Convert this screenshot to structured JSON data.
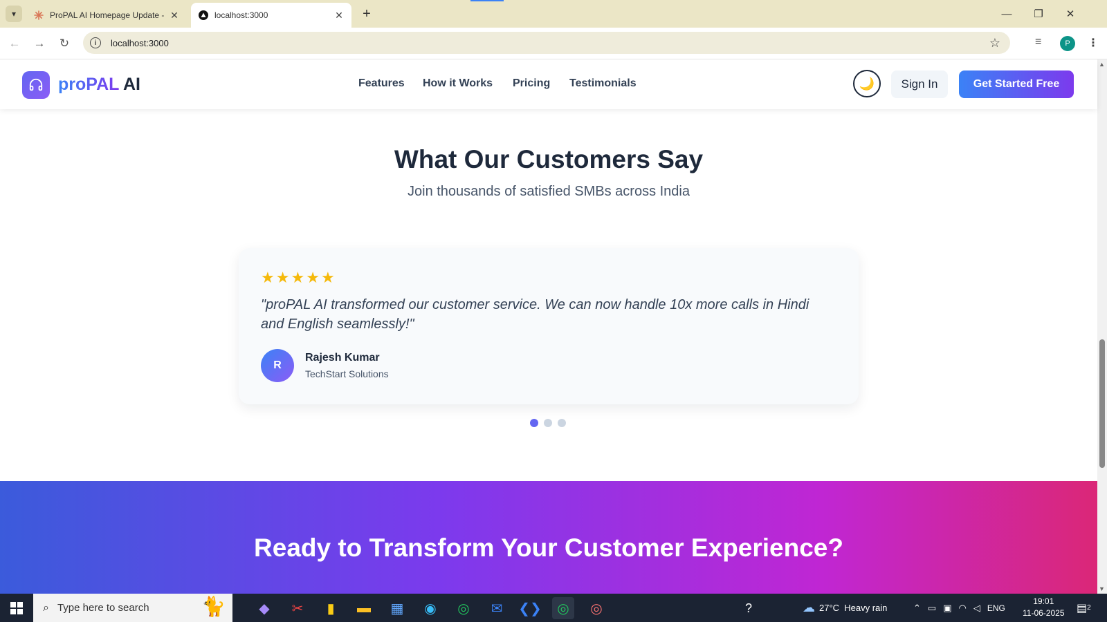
{
  "browser": {
    "tabs": [
      {
        "title": "ProPAL AI Homepage Update -",
        "icon": "claude-sunburst-icon"
      },
      {
        "title": "localhost:3000",
        "icon": "nextjs-triangle-icon"
      }
    ],
    "url": "localhost:3000",
    "profile_initial": "P"
  },
  "site": {
    "logo": {
      "brand": "proPAL",
      "suffix": "AI",
      "icon": "headphones-icon"
    },
    "nav": [
      "Features",
      "How it Works",
      "Pricing",
      "Testimonials"
    ],
    "theme_toggle_icon": "moon-icon",
    "sign_in": "Sign In",
    "cta": "Get Started Free"
  },
  "testimonials": {
    "title": "What Our Customers Say",
    "subtitle": "Join thousands of satisfied SMBs across India",
    "rating": 5,
    "quote": "\"proPAL AI transformed our customer service. We can now handle 10x more calls in Hindi and English seamlessly!\"",
    "avatar_initial": "R",
    "author": "Rajesh Kumar",
    "company": "TechStart Solutions",
    "carousel_pages": 3,
    "carousel_active": 1
  },
  "cta_band": {
    "title": "Ready to Transform Your Customer Experience?"
  },
  "taskbar": {
    "search_placeholder": "Type here to search",
    "weather": "27°C  Heavy rain",
    "language": "ENG",
    "time": "19:01",
    "date": "11-06-2025",
    "notification_count": "2"
  },
  "colors": {
    "accent": "#6366f1",
    "cta_gradient_start": "#3b82f6",
    "cta_gradient_end": "#7c3aed",
    "star": "#f5b90b"
  }
}
